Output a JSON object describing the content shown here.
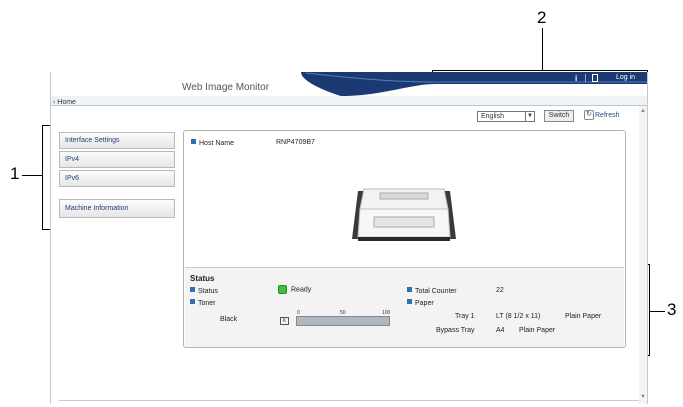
{
  "callouts": {
    "one": "1",
    "two": "2",
    "three": "3"
  },
  "window": {
    "app_title": "Web Image Monitor",
    "home_link": "‹ Home",
    "info_label": "i",
    "login_label": "Log in"
  },
  "toolbar": {
    "language": "English",
    "switch_label": "Switch",
    "refresh_label": "Refresh"
  },
  "menu": {
    "items": [
      {
        "label": "Interface Settings"
      },
      {
        "label": "IPv4"
      },
      {
        "label": "IPv6"
      },
      {
        "label": "Machine Information"
      }
    ]
  },
  "device": {
    "host_name_label": "Host Name",
    "host_name_value": "RNP4709B7"
  },
  "status": {
    "title": "Status",
    "status_label": "Status",
    "status_value": "Ready",
    "toner_label": "Toner",
    "toner_color": "Black",
    "toner_ticks": [
      "0",
      "50",
      "100"
    ],
    "toner_level_percent": 100,
    "total_counter_label": "Total Counter",
    "total_counter_value": "22",
    "paper_label": "Paper",
    "trays": [
      {
        "name": "Tray 1",
        "size": "LT (8 1/2 x 11)",
        "type": "Plain Paper"
      },
      {
        "name": "Bypass Tray",
        "size": "A4",
        "type": "Plain Paper"
      }
    ]
  },
  "colors": {
    "header_navy": "#1b3a73",
    "accent_blue": "#2f6fb3",
    "ready_green": "#3fbf3f"
  }
}
